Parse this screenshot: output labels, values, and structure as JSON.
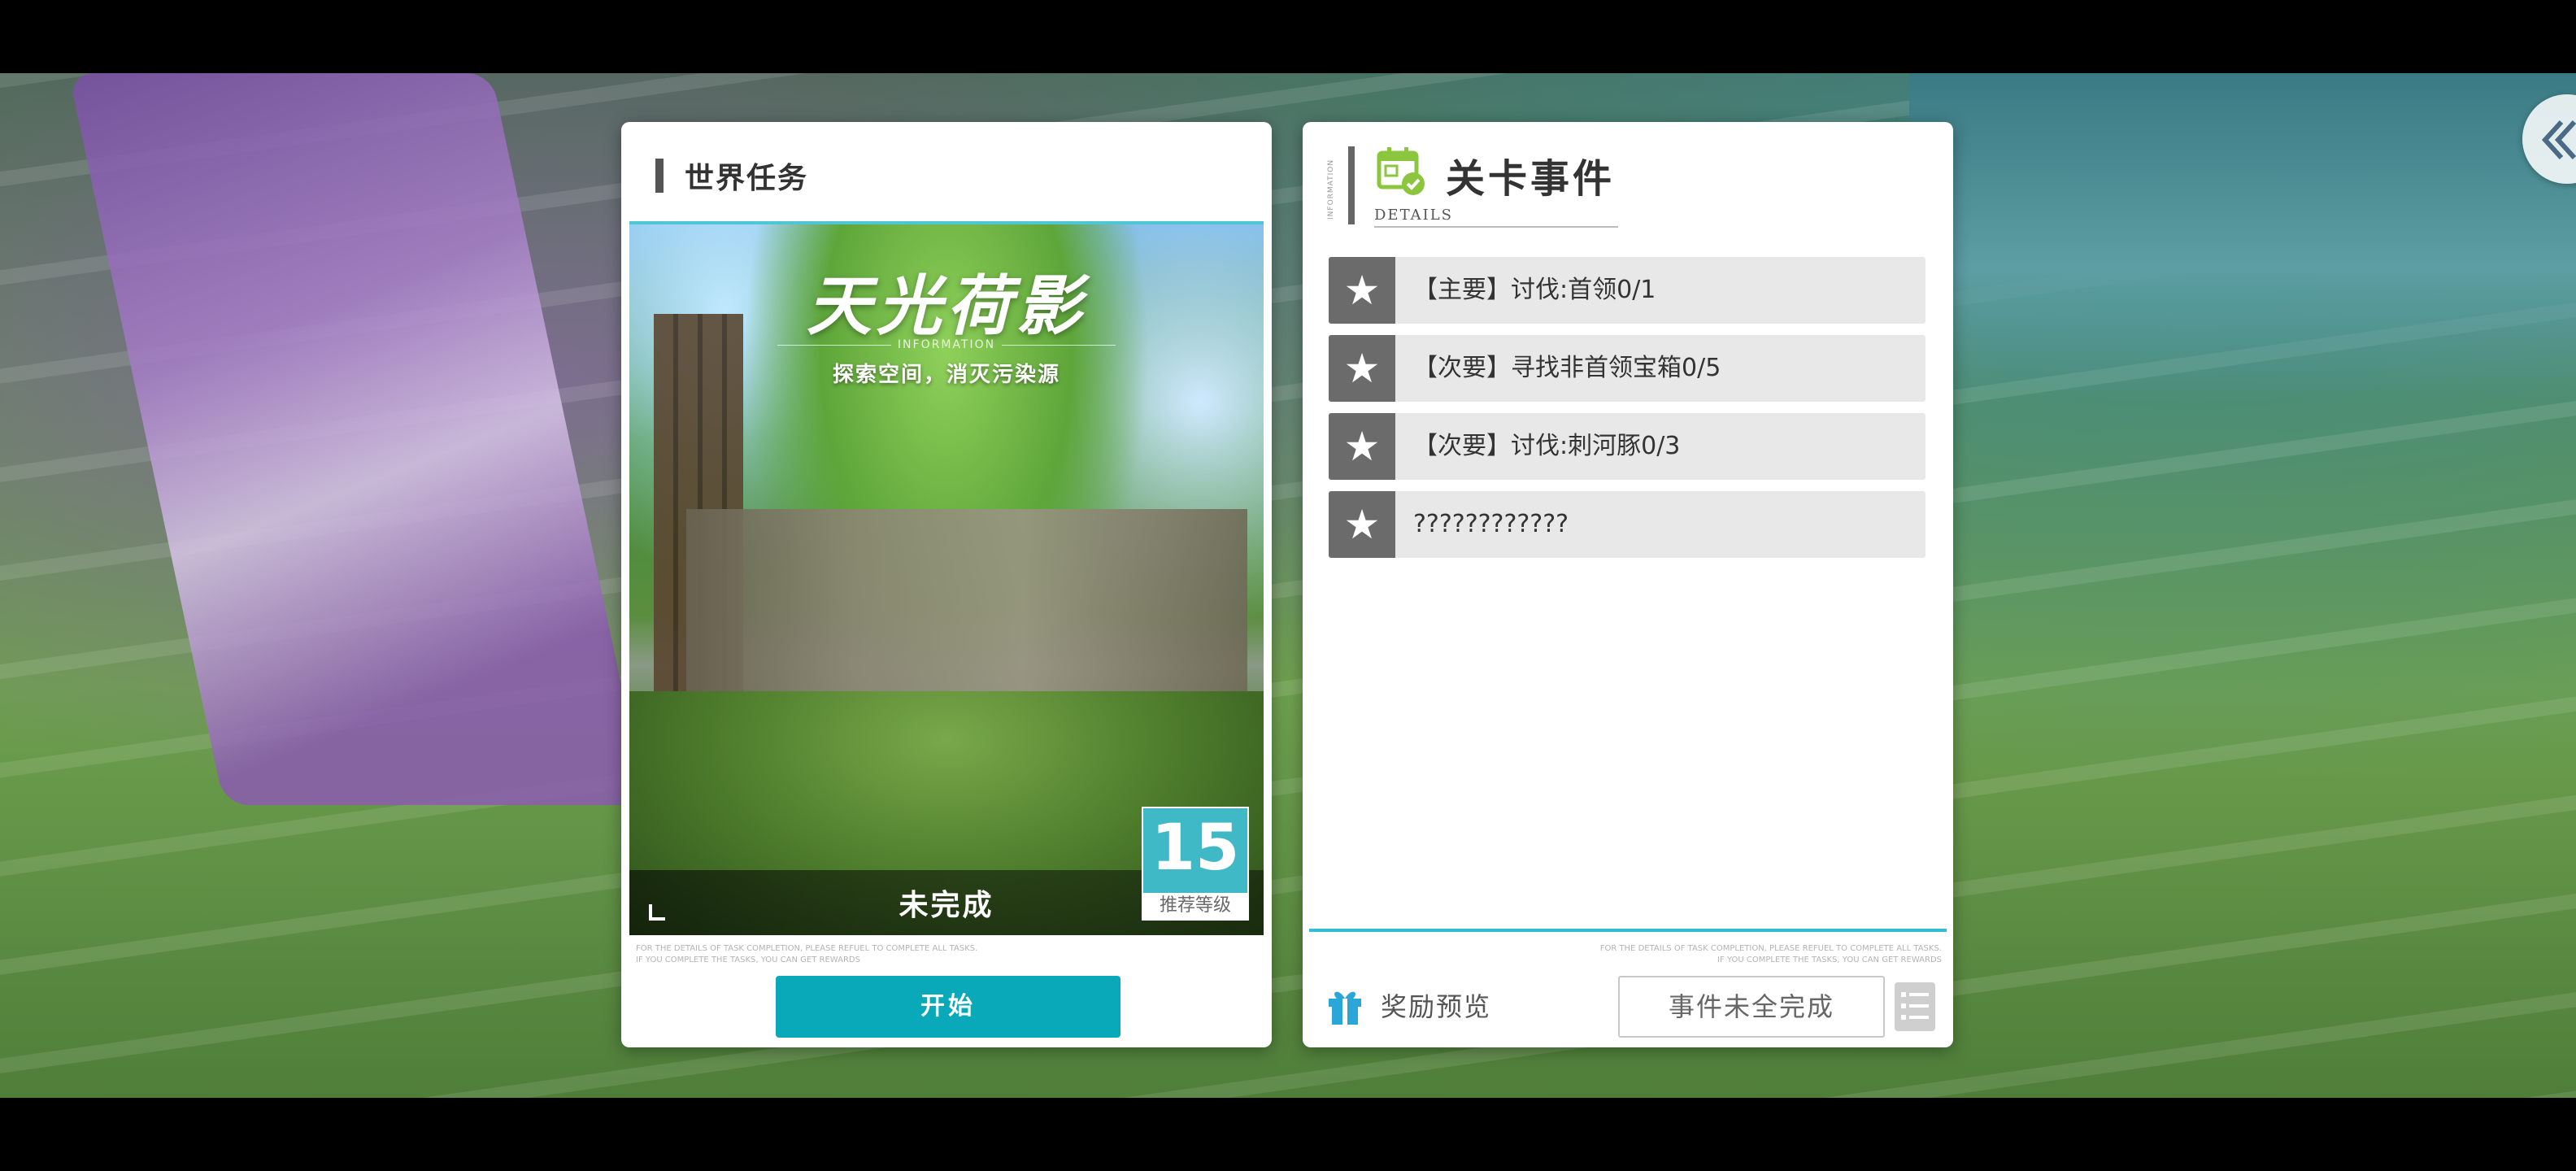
{
  "world_task": {
    "header_title": "世界任务",
    "art_title": "天光荷影",
    "art_info": "INFORMATION",
    "art_subtitle": "探索空间，消灭污染源",
    "status": "未完成",
    "level_number": "15",
    "level_label": "推荐等级",
    "fine_print_line1": "FOR THE DETAILS OF TASK COMPLETION, PLEASE REFUEL TO COMPLETE ALL TASKS.",
    "fine_print_line2": "IF YOU COMPLETE THE TASKS, YOU CAN GET REWARDS",
    "start_label": "开始"
  },
  "level_events": {
    "vertical_label": "INFORMATION",
    "title": "关卡事件",
    "subtitle": "DETAILS",
    "events": [
      {
        "text": "【主要】讨伐:首领0/1"
      },
      {
        "text": "【次要】寻找非首领宝箱0/5"
      },
      {
        "text": "【次要】讨伐:刺河豚0/3"
      },
      {
        "text": "????????????"
      }
    ],
    "fine_print_line1": "FOR THE DETAILS OF TASK COMPLETION, PLEASE REFUEL TO COMPLETE ALL TASKS.",
    "fine_print_line2": "IF YOU COMPLETE THE TASKS, YOU CAN GET REWARDS",
    "reward_label": "奖励预览",
    "incomplete_label": "事件未全完成"
  },
  "icons": {
    "back": "back-chevron-icon",
    "calendar": "calendar-check-icon",
    "star": "star-icon",
    "gift": "gift-icon",
    "list": "list-icon"
  },
  "colors": {
    "accent": "#0aa9b9",
    "badge": "#3fb9c6",
    "divider": "#33bcd6",
    "star_bg": "#6b6b6b",
    "calendar_green": "#8cc63f"
  }
}
